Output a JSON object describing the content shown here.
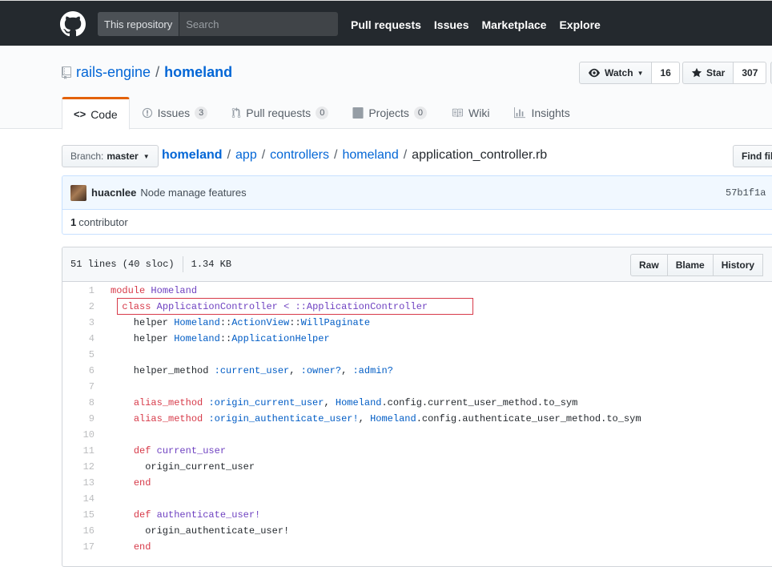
{
  "header": {
    "scope_label": "This repository",
    "search_placeholder": "Search",
    "nav": [
      "Pull requests",
      "Issues",
      "Marketplace",
      "Explore"
    ]
  },
  "repo": {
    "owner": "rails-engine",
    "name": "homeland",
    "watch_label": "Watch",
    "watch_count": "16",
    "star_label": "Star",
    "star_count": "307"
  },
  "tabs": [
    {
      "label": "Code",
      "count": null,
      "selected": true
    },
    {
      "label": "Issues",
      "count": "3"
    },
    {
      "label": "Pull requests",
      "count": "0"
    },
    {
      "label": "Projects",
      "count": "0"
    },
    {
      "label": "Wiki",
      "count": null
    },
    {
      "label": "Insights",
      "count": null
    }
  ],
  "branch": {
    "label": "Branch:",
    "value": "master"
  },
  "breadcrumb": {
    "parts": [
      "homeland",
      "app",
      "controllers",
      "homeland"
    ],
    "file": "application_controller.rb"
  },
  "find_file_label": "Find file",
  "commit": {
    "author": "huacnlee",
    "message": "Node manage features",
    "sha": "57b1f1a",
    "contributors_count": "1",
    "contributors_label": "contributor"
  },
  "file": {
    "lines_info": "51 lines (40 sloc)",
    "size": "1.34 KB",
    "actions": [
      "Raw",
      "Blame",
      "History"
    ]
  },
  "code_lines": [
    "module Homeland",
    "  class ApplicationController < ::ApplicationController",
    "    helper Homeland::ActionView::WillPaginate",
    "    helper Homeland::ApplicationHelper",
    "",
    "    helper_method :current_user, :owner?, :admin?",
    "",
    "    alias_method :origin_current_user, Homeland.config.current_user_method.to_sym",
    "    alias_method :origin_authenticate_user!, Homeland.config.authenticate_user_method.to_sym",
    "",
    "    def current_user",
    "      origin_current_user",
    "    end",
    "",
    "    def authenticate_user!",
    "      origin_authenticate_user!",
    "    end"
  ],
  "highlighted_line": 2,
  "colors": {
    "header_bg": "#24292e",
    "link": "#0366d6",
    "selected_tab_accent": "#e36209",
    "highlight_border": "#d73a49"
  }
}
